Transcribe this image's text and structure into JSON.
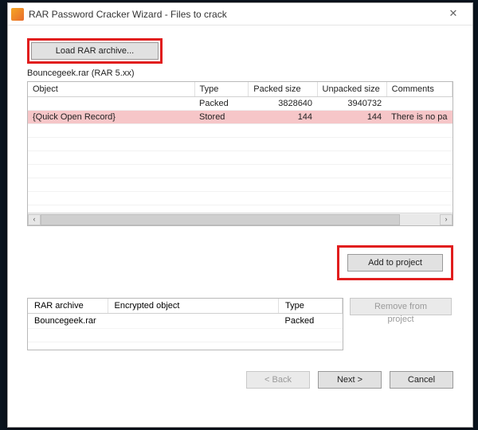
{
  "window": {
    "title": "RAR Password Cracker Wizard - Files to crack"
  },
  "buttons": {
    "load": "Load RAR archive...",
    "add": "Add to project",
    "remove": "Remove from project",
    "back": "< Back",
    "next": "Next >",
    "cancel": "Cancel"
  },
  "filename": "Bouncegeek.rar (RAR 5.xx)",
  "table1": {
    "headers": {
      "object": "Object",
      "type": "Type",
      "packed": "Packed size",
      "unpacked": "Unpacked size",
      "comments": "Comments"
    },
    "rows": [
      {
        "object": "",
        "type": "Packed",
        "packed": "3828640",
        "unpacked": "3940732",
        "comments": ""
      },
      {
        "object": "{Quick Open Record}",
        "type": "Stored",
        "packed": "144",
        "unpacked": "144",
        "comments": "There is no pa"
      }
    ]
  },
  "table2": {
    "headers": {
      "archive": "RAR archive",
      "encobj": "Encrypted object",
      "type": "Type"
    },
    "rows": [
      {
        "archive": "Bouncegeek.rar",
        "encobj": "",
        "type": "Packed"
      }
    ]
  }
}
